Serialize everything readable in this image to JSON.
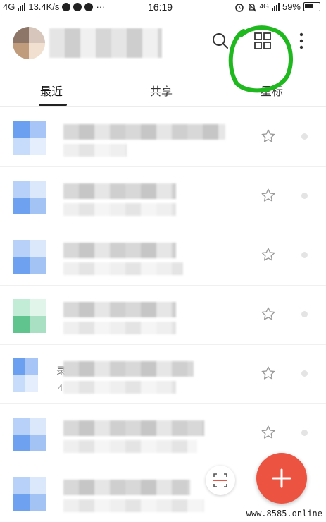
{
  "status_bar": {
    "network": "4G",
    "speed": "13.4K/s",
    "time": "16:19",
    "network_right": "4G",
    "battery": "59%"
  },
  "header": {
    "icons": [
      "search-icon",
      "grid-view-icon",
      "more-icon"
    ]
  },
  "tabs": [
    {
      "label": "最近",
      "active": true
    },
    {
      "label": "共享",
      "active": false
    },
    {
      "label": "星标",
      "active": false
    }
  ],
  "files": [
    {
      "icon": "doc-blue",
      "starred": false
    },
    {
      "icon": "doc-blue",
      "starred": false
    },
    {
      "icon": "doc-blue",
      "starred": false
    },
    {
      "icon": "sheet-green",
      "starred": false
    },
    {
      "icon": "doc-blue",
      "starred": false,
      "partial_char": "录",
      "partial_meta": "4"
    },
    {
      "icon": "doc-blue",
      "starred": false
    },
    {
      "icon": "doc-blue",
      "starred": false
    }
  ],
  "fab": {
    "symbol": "+"
  },
  "watermark": "www.8585.online",
  "colors": {
    "accent_red": "#ec5341",
    "highlight_green": "#1fb81f",
    "doc_blue": "#6b9ff0",
    "sheet_green": "#5fc48d"
  }
}
